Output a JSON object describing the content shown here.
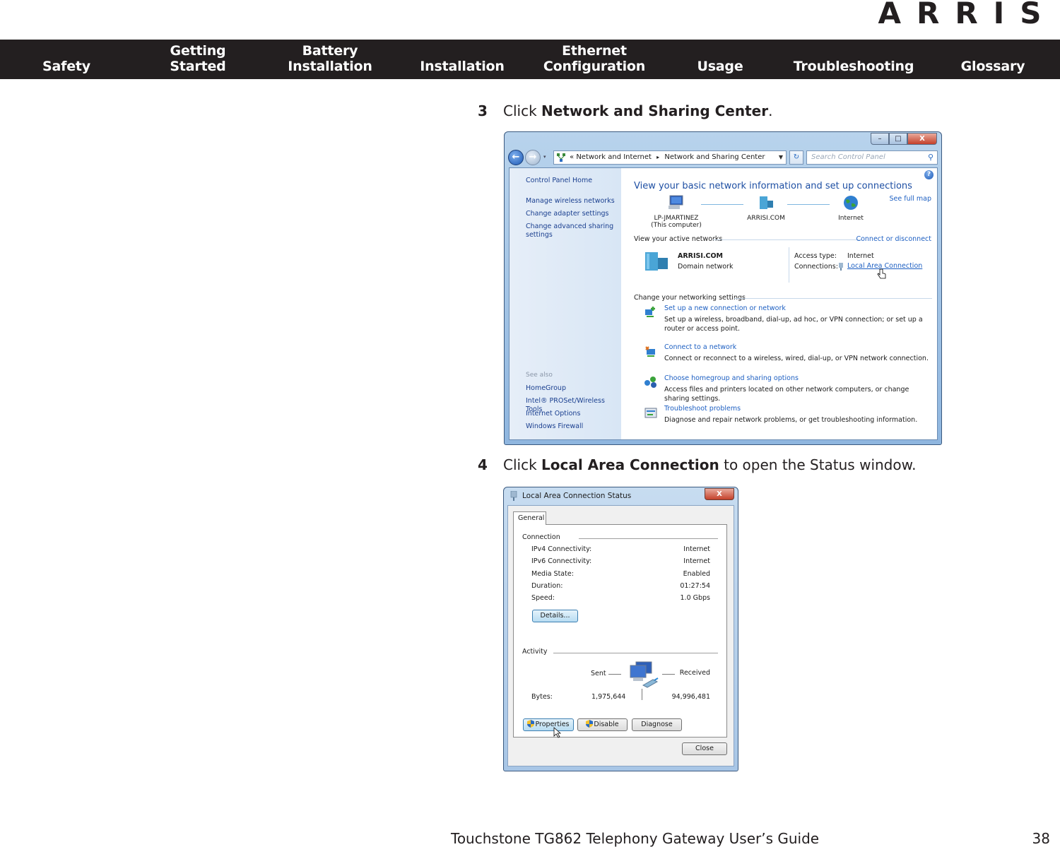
{
  "brand": {
    "logo_text": "ARRIS"
  },
  "nav": {
    "items": [
      {
        "line1": "",
        "line2": "Safety"
      },
      {
        "line1": "Getting",
        "line2": "Started"
      },
      {
        "line1": "Battery",
        "line2": "Installation"
      },
      {
        "line1": "",
        "line2": "Installation"
      },
      {
        "line1": "Ethernet",
        "line2": "Configuration"
      },
      {
        "line1": "",
        "line2": "Usage"
      },
      {
        "line1": "",
        "line2": "Troubleshooting"
      },
      {
        "line1": "",
        "line2": "Glossary"
      }
    ]
  },
  "steps": [
    {
      "number": "3",
      "prefix": "Click ",
      "bold": "Network and Sharing Center",
      "suffix": "."
    },
    {
      "number": "4",
      "prefix": "Click ",
      "bold": "Local Area Connection",
      "suffix": " to open the Status window."
    }
  ],
  "network_sharing_window": {
    "window_controls": {
      "minimize": "–",
      "maximize": "□",
      "close": "X"
    },
    "back": "←",
    "forward": "→",
    "breadcrumb": {
      "chevron": "«",
      "part1": "Network and Internet",
      "separator": "▸",
      "part2": "Network and Sharing Center"
    },
    "refresh": "↻",
    "search_placeholder": "Search Control Panel",
    "search_icon": "⚲",
    "help": "?",
    "left_pane": {
      "links": [
        "Control Panel Home",
        "Manage wireless networks",
        "Change adapter settings",
        "Change advanced sharing",
        "settings"
      ],
      "see_also_label": "See also",
      "see_also": [
        "HomeGroup",
        "Intel® PROSet/Wireless Tools",
        "Internet Options",
        "Windows Firewall"
      ]
    },
    "title": "View your basic network information and set up connections",
    "see_full_map": "See full map",
    "map": [
      {
        "name": "LP-JMARTINEZ",
        "sub": "(This computer)"
      },
      {
        "name": "ARRISI.COM",
        "sub": ""
      },
      {
        "name": "Internet",
        "sub": ""
      }
    ],
    "active_networks_label": "View your active networks",
    "connect_or_disconnect": "Connect or disconnect",
    "active_network": {
      "name": "ARRISI.COM",
      "type": "Domain network",
      "access_type_label": "Access type:",
      "access_type_value": "Internet",
      "connections_label": "Connections:",
      "connections_value": "Local Area Connection"
    },
    "change_settings_label": "Change your networking settings",
    "tasks": [
      {
        "title": "Set up a new connection or network",
        "desc": "Set up a wireless, broadband, dial-up, ad hoc, or VPN connection; or set up a router or access point."
      },
      {
        "title": "Connect to a network",
        "desc": "Connect or reconnect to a wireless, wired, dial-up, or VPN network connection."
      },
      {
        "title": "Choose homegroup and sharing options",
        "desc": "Access files and printers located on other network computers, or change sharing settings."
      },
      {
        "title": "Troubleshoot problems",
        "desc": "Diagnose and repair network problems, or get troubleshooting information."
      }
    ]
  },
  "status_window": {
    "title": "Local Area Connection Status",
    "close": "X",
    "tab": "General",
    "connection_label": "Connection",
    "connection": [
      {
        "key": "IPv4 Connectivity:",
        "value": "Internet"
      },
      {
        "key": "IPv6 Connectivity:",
        "value": "Internet"
      },
      {
        "key": "Media State:",
        "value": "Enabled"
      },
      {
        "key": "Duration:",
        "value": "01:27:54"
      },
      {
        "key": "Speed:",
        "value": "1.0 Gbps"
      }
    ],
    "details_button": "Details...",
    "activity_label": "Activity",
    "sent_label": "Sent",
    "received_label": "Received",
    "bytes_label": "Bytes:",
    "bytes_sent": "1,975,644",
    "bytes_received": "94,996,481",
    "properties_button": "Properties",
    "disable_button": "Disable",
    "diagnose_button": "Diagnose",
    "close_button": "Close"
  },
  "footer": {
    "title": "Touchstone TG862 Telephony Gateway User’s Guide",
    "page": "38"
  }
}
